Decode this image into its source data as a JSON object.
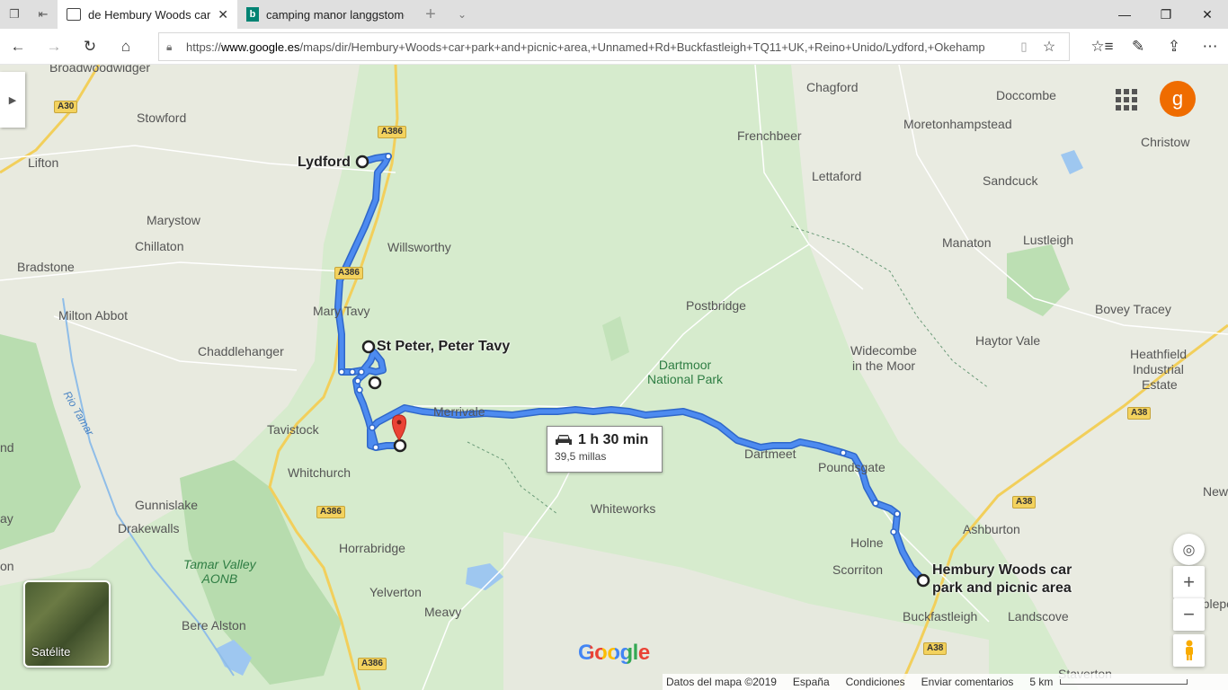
{
  "browser": {
    "tabs": [
      {
        "title": "de Hembury Woods car",
        "active": true
      },
      {
        "title": "camping manor langgstome",
        "active": false
      }
    ],
    "address": {
      "prefix": "https://",
      "domain": "www.google.es",
      "path": "/maps/dir/Hembury+Woods+car+park+and+picnic+area,+Unnamed+Rd+Buckfastleigh+TQ11+UK,+Reino+Unido/Lydford,+Okehamp"
    }
  },
  "map": {
    "stops": {
      "lydford": "Lydford",
      "peter_tavy": "St Peter, Peter Tavy",
      "hembury_line1": "Hembury Woods car",
      "hembury_line2": "park and picnic area"
    },
    "places": {
      "broadwoodwidger": "Broadwoodwidger",
      "stowford": "Stowford",
      "lifton": "Lifton",
      "marystow": "Marystow",
      "chillaton": "Chillaton",
      "bradstone": "Bradstone",
      "milton_abbot": "Milton Abbot",
      "chaddlehanger": "Chaddlehanger",
      "mary_tavy": "Mary Tavy",
      "willsworthy": "Willsworthy",
      "tavistock": "Tavistock",
      "whitchurch": "Whitchurch",
      "gunnislake": "Gunnislake",
      "drakewalls": "Drakewalls",
      "horrabridge": "Horrabridge",
      "yelverton": "Yelverton",
      "meavy": "Meavy",
      "bere_alston": "Bere Alston",
      "merrivale": "Merrivale",
      "whiteworks": "Whiteworks",
      "dartmeet": "Dartmeet",
      "poundsgate": "Poundsgate",
      "holne": "Holne",
      "scorriton": "Scorriton",
      "buckfastleigh": "Buckfastleigh",
      "ashburton": "Ashburton",
      "landscove": "Landscove",
      "staverton": "Staverton",
      "postbridge": "Postbridge",
      "widecombe_1": "Widecombe",
      "widecombe_2": "in the Moor",
      "haytor_vale": "Haytor Vale",
      "chagford": "Chagford",
      "frenchbeer": "Frenchbeer",
      "lettaford": "Lettaford",
      "doccombe": "Doccombe",
      "moretonhampstead": "Moretonhampstead",
      "christow": "Christow",
      "sandcuck": "Sandcuck",
      "manaton": "Manaton",
      "lustleigh": "Lustleigh",
      "bovey_tracey": "Bovey Tracey",
      "heathfield_1": "Heathfield",
      "heathfield_2": "Industrial",
      "heathfield_3": "Estate",
      "edge_nd": "nd",
      "edge_ay": "ay",
      "edge_on": "on",
      "edge_new": "New",
      "edge_ipplepen": "Ipplepen"
    },
    "park": {
      "line1": "Dartmoor",
      "line2": "National Park"
    },
    "aonb": {
      "line1": "Tamar Valley",
      "line2": "AONB"
    },
    "river": "Rio Tamar",
    "roads": {
      "a30": "A30",
      "a386_north": "A386",
      "a386_mid": "A386",
      "a386_south": "A386",
      "a386_bottom": "A386",
      "a38_east": "A38",
      "a38_mid": "A38",
      "a38_south": "A38"
    },
    "route": {
      "duration": "1 h 30 min",
      "distance": "39,5 millas"
    },
    "avatar_letter": "g",
    "satellite_label": "Satélite",
    "logo": "Google",
    "footer": {
      "data": "Datos del mapa ©2019",
      "country": "España",
      "terms": "Condiciones",
      "feedback": "Enviar comentarios",
      "scale": "5 km"
    },
    "colors": {
      "route": "#4d8bf0",
      "route_border": "#2f67c9",
      "pin": "#ea4335",
      "avatar": "#ef6c00"
    }
  }
}
